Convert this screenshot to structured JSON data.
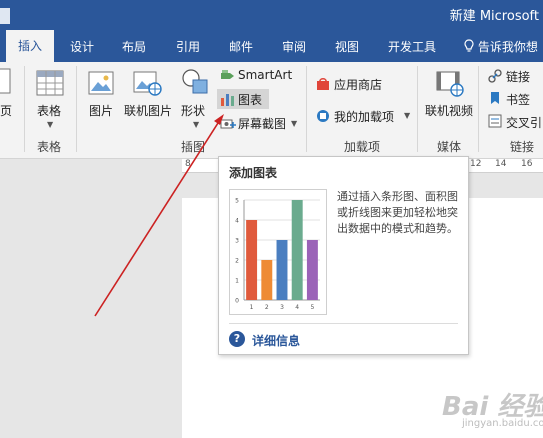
{
  "window": {
    "title": "新建 Microsoft"
  },
  "tabs": [
    {
      "label": "插入",
      "active": true
    },
    {
      "label": "设计"
    },
    {
      "label": "布局"
    },
    {
      "label": "引用"
    },
    {
      "label": "邮件"
    },
    {
      "label": "审阅"
    },
    {
      "label": "视图"
    },
    {
      "label": "开发工具"
    }
  ],
  "tellme": {
    "label": "告诉我你想"
  },
  "ribbon": {
    "pages_group": {
      "partial_label": "页"
    },
    "tables_group": {
      "table_label": "表格",
      "group_label": "表格"
    },
    "illustrations_group": {
      "picture_label": "图片",
      "online_picture_label": "联机图片",
      "shapes_label": "形状",
      "smartart_label": "SmartArt",
      "chart_label": "图表",
      "screenshot_label": "屏幕截图",
      "group_label": "插图"
    },
    "addins_group": {
      "store_label": "应用商店",
      "my_addins_label": "我的加载项",
      "group_label": "加载项"
    },
    "media_group": {
      "online_video_label": "联机视频",
      "group_label": "媒体"
    },
    "links_group": {
      "link_label": "链接",
      "bookmark_label": "书签",
      "crossref_label": "交叉引",
      "group_label": "链接"
    }
  },
  "ruler": {
    "numbers": [
      "8",
      "12",
      "14",
      "16"
    ]
  },
  "tooltip": {
    "title": "添加图表",
    "description": "通过插入条形图、面积图或折线图来更加轻松地突出数据中的模式和趋势。",
    "help_label": "详细信息",
    "preview_chart": {
      "type": "bar",
      "categories": [
        "1",
        "2",
        "3",
        "4",
        "5"
      ],
      "values": [
        4,
        2,
        3,
        5,
        3
      ],
      "ylim": [
        0,
        5
      ],
      "yticks": [
        "0",
        "1",
        "2",
        "3",
        "4",
        "5"
      ],
      "colors": [
        "#e05a3c",
        "#ee8b35",
        "#4a7ec0",
        "#6aab8e",
        "#9b63b8"
      ]
    }
  },
  "watermark": {
    "text": "Bai 经验",
    "sub": "jingyan.baidu.com"
  },
  "colors": {
    "accent": "#2b579a",
    "ribbon_bg": "#f3f3f3",
    "annotation_arrow": "#cc2222"
  }
}
